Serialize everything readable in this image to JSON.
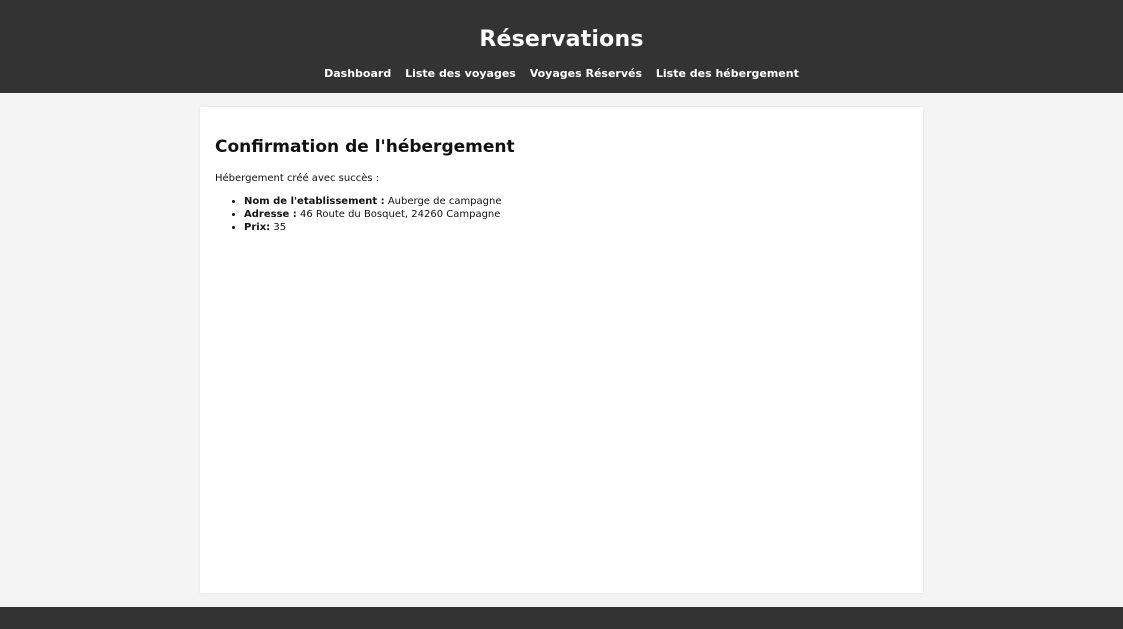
{
  "header": {
    "title": "Réservations",
    "nav": [
      {
        "label": "Dashboard"
      },
      {
        "label": "Liste des voyages"
      },
      {
        "label": "Voyages Réservés"
      },
      {
        "label": "Liste des hébergement"
      }
    ]
  },
  "main": {
    "title": "Confirmation de l'hébergement",
    "success_message": "Hébergement créé avec succès :",
    "details": [
      {
        "label": "Nom de l'etablissement :",
        "value": "Auberge de campagne"
      },
      {
        "label": "Adresse :",
        "value": "46 Route du Bosquet, 24260 Campagne"
      },
      {
        "label": "Prix:",
        "value": "35"
      }
    ]
  },
  "colors": {
    "header_bg": "#333333",
    "page_bg": "#f4f4f4",
    "card_bg": "#ffffff",
    "footer_bg": "#333333"
  }
}
